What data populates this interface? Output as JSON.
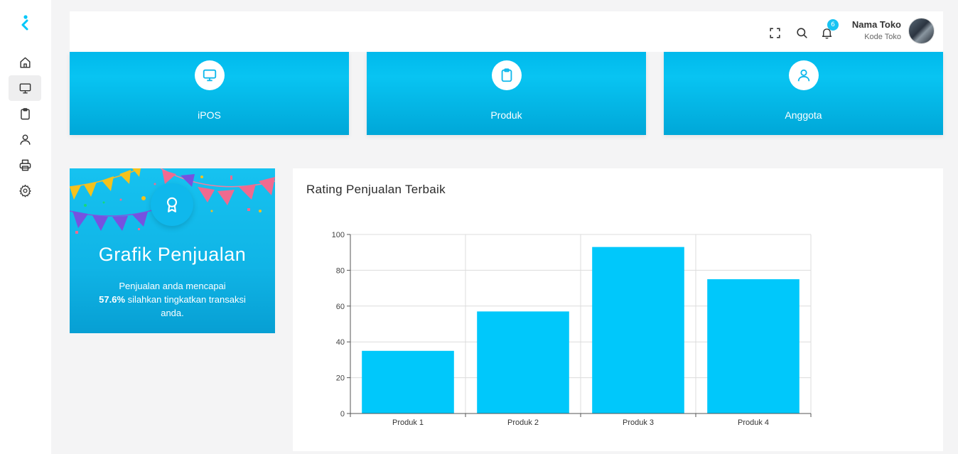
{
  "sidebar": {
    "logo_icon": "brand-logo",
    "items": [
      {
        "name": "home",
        "icon": "home-icon",
        "active": false
      },
      {
        "name": "pos",
        "icon": "monitor-icon",
        "active": true
      },
      {
        "name": "produk",
        "icon": "clipboard-icon",
        "active": false
      },
      {
        "name": "anggota",
        "icon": "user-icon",
        "active": false
      },
      {
        "name": "print",
        "icon": "printer-icon",
        "active": false
      },
      {
        "name": "settings",
        "icon": "gear-icon",
        "active": false
      }
    ]
  },
  "header": {
    "icons": [
      "fullscreen-icon",
      "search-icon",
      "bell-icon"
    ],
    "notification_count": "6",
    "user_name": "Nama Toko",
    "user_code": "Kode Toko"
  },
  "tiles": [
    {
      "label": "iPOS",
      "icon": "monitor-icon"
    },
    {
      "label": "Produk",
      "icon": "clipboard-icon"
    },
    {
      "label": "Anggota",
      "icon": "user-icon"
    }
  ],
  "promo": {
    "title": "Grafik Penjualan",
    "text_before": "Penjualan anda mencapai",
    "highlight": "57.6%",
    "text_after": "silahkan tingkatkan transaksi anda.",
    "icon": "award-icon"
  },
  "colors": {
    "accent": "#00c7fa",
    "tile": "#08c4f2",
    "bar": "#00c8fb"
  },
  "chart_data": {
    "type": "bar",
    "title": "Rating Penjualan Terbaik",
    "categories": [
      "Produk 1",
      "Produk 2",
      "Produk 3",
      "Produk 4"
    ],
    "values": [
      35,
      57,
      93,
      75
    ],
    "ylim": [
      0,
      100
    ],
    "yticks": [
      "0",
      "20",
      "40",
      "60",
      "80",
      "100"
    ],
    "grid": true,
    "xlabel": "",
    "ylabel": ""
  }
}
